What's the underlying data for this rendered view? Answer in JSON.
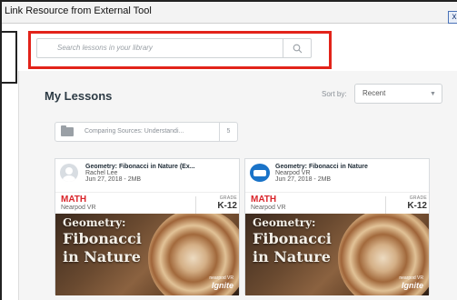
{
  "window": {
    "title": "Link Resource from External Tool",
    "close_glyph": "x"
  },
  "search": {
    "placeholder": "Search lessons in your library",
    "icon": "search-icon"
  },
  "library": {
    "heading": "My Lessons",
    "sort_label": "Sort by:",
    "sort_value": "Recent"
  },
  "folder": {
    "name": "Comparing Sources: Understandi...",
    "count": "5"
  },
  "cards": [
    {
      "title": "Geometry: Fibonacci in Nature (Ex...",
      "author": "Rachel Lee",
      "meta": "Jun 27, 2018 - 2MB",
      "subject": "MATH",
      "source": "Nearpod VR",
      "grade_label": "GRADE",
      "grade": "K-12",
      "thumb_line1": "Geometry:",
      "thumb_line2": "Fibonacci",
      "thumb_line3": "in Nature",
      "brand_small": "nearpod VR",
      "brand_big": "Ignite"
    },
    {
      "title": "Geometry: Fibonacci in Nature",
      "author": "Nearpod VR",
      "meta": "Jun 27, 2018 - 2MB",
      "subject": "MATH",
      "source": "Nearpod VR",
      "grade_label": "GRADE",
      "grade": "K-12",
      "thumb_line1": "Geometry:",
      "thumb_line2": "Fibonacci",
      "thumb_line3": "in Nature",
      "brand_small": "nearpod VR",
      "brand_big": "Ignite"
    }
  ],
  "colors": {
    "highlight": "#e2231a",
    "subject": "#d9242a",
    "vr_badge": "#1a73c8"
  }
}
